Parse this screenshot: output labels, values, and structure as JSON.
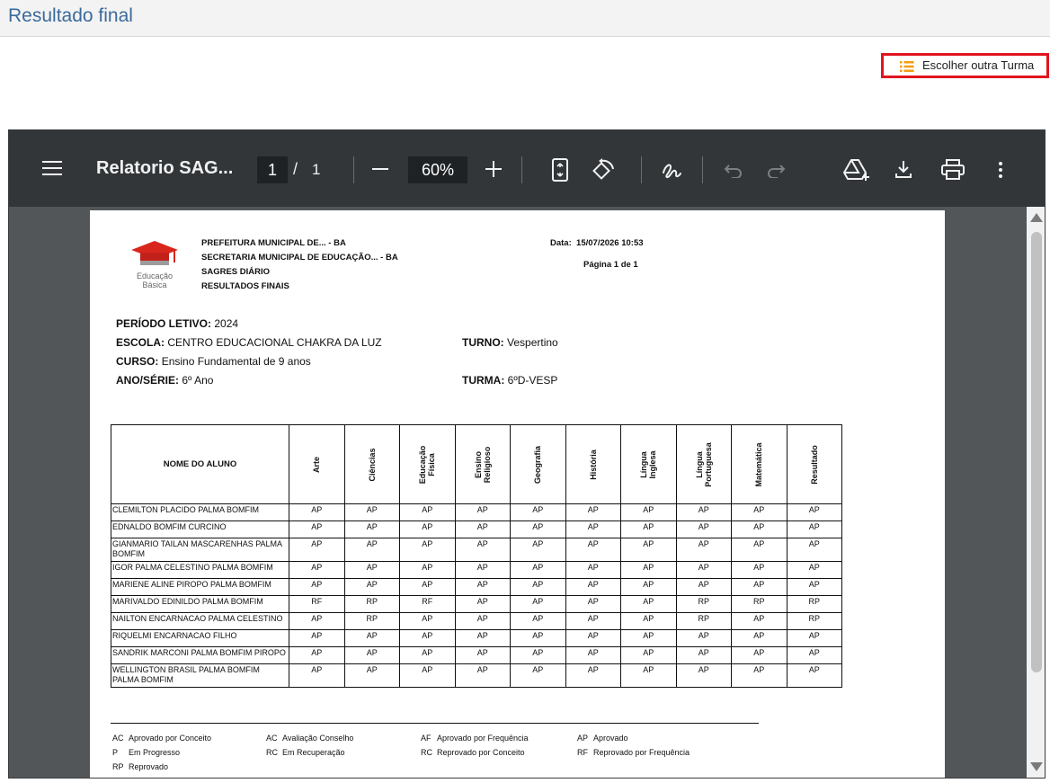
{
  "header": {
    "title": "Resultado final"
  },
  "actions": {
    "choose_class_label": "Escolher outra Turma"
  },
  "viewer": {
    "doc_title": "Relatorio SAG...",
    "page_current": "1",
    "page_sep": "/",
    "page_total": "1",
    "zoom": "60%"
  },
  "report": {
    "org_lines": [
      "PREFEITURA MUNICIPAL DE... - BA",
      "SECRETARIA MUNICIPAL DE EDUCAÇÃO... - BA",
      "SAGRES DIÁRIO",
      "RESULTADOS FINAIS"
    ],
    "logo_text": [
      "Educação",
      "Básica"
    ],
    "date_label": "Data:",
    "date_value": "15/07/2026 10:53",
    "page_info": "Página 1 de 1",
    "periodo_label": "PERÍODO LETIVO:",
    "periodo_value": "2024",
    "escola_label": "ESCOLA:",
    "escola_value": "CENTRO EDUCACIONAL CHAKRA DA LUZ",
    "turno_label": "TURNO:",
    "turno_value": "Vespertino",
    "curso_label": "CURSO:",
    "curso_value": "Ensino Fundamental de 9 anos",
    "ano_label": "ANO/SÉRIE:",
    "ano_value": "6º Ano",
    "turma_label": "TURMA:",
    "turma_value": "6ºD-VESP",
    "table": {
      "name_header": "NOME DO ALUNO",
      "subjects": [
        [
          "Arte"
        ],
        [
          "Ciências"
        ],
        [
          "Educação",
          "Física"
        ],
        [
          "Ensino",
          "Religioso"
        ],
        [
          "Geografia"
        ],
        [
          "História"
        ],
        [
          "Língua",
          "Inglesa"
        ],
        [
          "Língua",
          "Portuguesa"
        ],
        [
          "Matemática"
        ],
        [
          "Resultado"
        ]
      ],
      "rows": [
        {
          "name": "CLEMILTON PLACIDO PALMA BOMFIM",
          "grades": [
            "AP",
            "AP",
            "AP",
            "AP",
            "AP",
            "AP",
            "AP",
            "AP",
            "AP",
            "AP"
          ]
        },
        {
          "name": "EDNALDO BOMFIM CURCINO",
          "grades": [
            "AP",
            "AP",
            "AP",
            "AP",
            "AP",
            "AP",
            "AP",
            "AP",
            "AP",
            "AP"
          ]
        },
        {
          "name": "GIANMARIO TAILAN MASCARENHAS PALMA BOMFIM",
          "grades": [
            "AP",
            "AP",
            "AP",
            "AP",
            "AP",
            "AP",
            "AP",
            "AP",
            "AP",
            "AP"
          ]
        },
        {
          "name": "IGOR PALMA CELESTINO PALMA BOMFIM",
          "grades": [
            "AP",
            "AP",
            "AP",
            "AP",
            "AP",
            "AP",
            "AP",
            "AP",
            "AP",
            "AP"
          ]
        },
        {
          "name": "MARIENE ALINE PIROPO PALMA BOMFIM",
          "grades": [
            "AP",
            "AP",
            "AP",
            "AP",
            "AP",
            "AP",
            "AP",
            "AP",
            "AP",
            "AP"
          ]
        },
        {
          "name": "MARIVALDO EDINILDO PALMA BOMFIM",
          "grades": [
            "RF",
            "RP",
            "RF",
            "AP",
            "AP",
            "AP",
            "AP",
            "RP",
            "RP",
            "RP"
          ]
        },
        {
          "name": "NAILTON ENCARNACAO PALMA CELESTINO",
          "grades": [
            "AP",
            "RP",
            "AP",
            "AP",
            "AP",
            "AP",
            "AP",
            "RP",
            "AP",
            "RP"
          ]
        },
        {
          "name": "RIQUELMI ENCARNACAO FILHO",
          "grades": [
            "AP",
            "AP",
            "AP",
            "AP",
            "AP",
            "AP",
            "AP",
            "AP",
            "AP",
            "AP"
          ]
        },
        {
          "name": "SANDRIK MARCONI PALMA BOMFIM PIROPO",
          "grades": [
            "AP",
            "AP",
            "AP",
            "AP",
            "AP",
            "AP",
            "AP",
            "AP",
            "AP",
            "AP"
          ]
        },
        {
          "name": "WELLINGTON BRASIL PALMA BOMFIM PALMA BOMFIM",
          "grades": [
            "AP",
            "AP",
            "AP",
            "AP",
            "AP",
            "AP",
            "AP",
            "AP",
            "AP",
            "AP"
          ]
        }
      ]
    },
    "legend": [
      {
        "code": "AC",
        "text": "Aprovado por Conceito"
      },
      {
        "code": "AC",
        "text": "Avaliação Conselho"
      },
      {
        "code": "AF",
        "text": "Aprovado por Frequência"
      },
      {
        "code": "AP",
        "text": "Aprovado"
      },
      {
        "code": "P",
        "text": "Em Progresso"
      },
      {
        "code": "RC",
        "text": "Em Recuperação"
      },
      {
        "code": "RC",
        "text": "Reprovado por Conceito"
      },
      {
        "code": "RF",
        "text": "Reprovado por Frequência"
      },
      {
        "code": "RP",
        "text": "Reprovado"
      }
    ]
  },
  "colors": {
    "title": "#3a6a9c",
    "button_border": "#e0151f",
    "list_icon": "#f39c12",
    "toolbar": "#323639",
    "viewer_bg": "#525659"
  }
}
